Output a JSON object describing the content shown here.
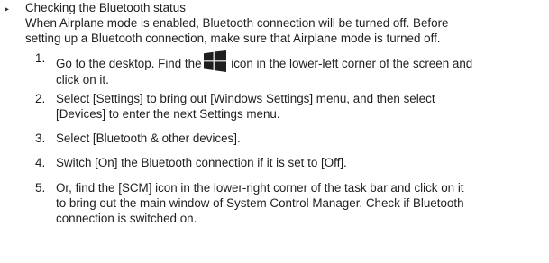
{
  "section": {
    "bullet_glyph": "▸",
    "heading": "Checking the Bluetooth status",
    "intro_line1": "When Airplane mode is enabled, Bluetooth connection will be turned off. Before",
    "intro_line2": "setting up a Bluetooth connection, make sure that Airplane mode is turned off."
  },
  "steps": [
    {
      "number": "1.",
      "line1_before_icon": "Go to the desktop. Find the",
      "icon": "windows-logo-icon",
      "line1_after_icon": " icon in the lower-left corner of the screen and",
      "line2": "click on it."
    },
    {
      "number": "2.",
      "line1": "Select [Settings] to bring out [Windows Settings] menu, and then select",
      "line2": "[Devices] to enter the next Settings menu."
    },
    {
      "number": "3.",
      "line1": "Select [Bluetooth & other devices]."
    },
    {
      "number": "4.",
      "line1": "Switch [On] the Bluetooth connection if it is set to [Off]."
    },
    {
      "number": "5.",
      "line1": "Or, find the [SCM] icon in the lower-right corner of the task bar and click on it",
      "line2": "to bring out the main window of System Control Manager.  Check if Bluetooth",
      "line3": "connection is switched on."
    }
  ],
  "colors": {
    "text": "#1e1e1e",
    "icon": "#1e1e1e",
    "background": "#ffffff"
  }
}
